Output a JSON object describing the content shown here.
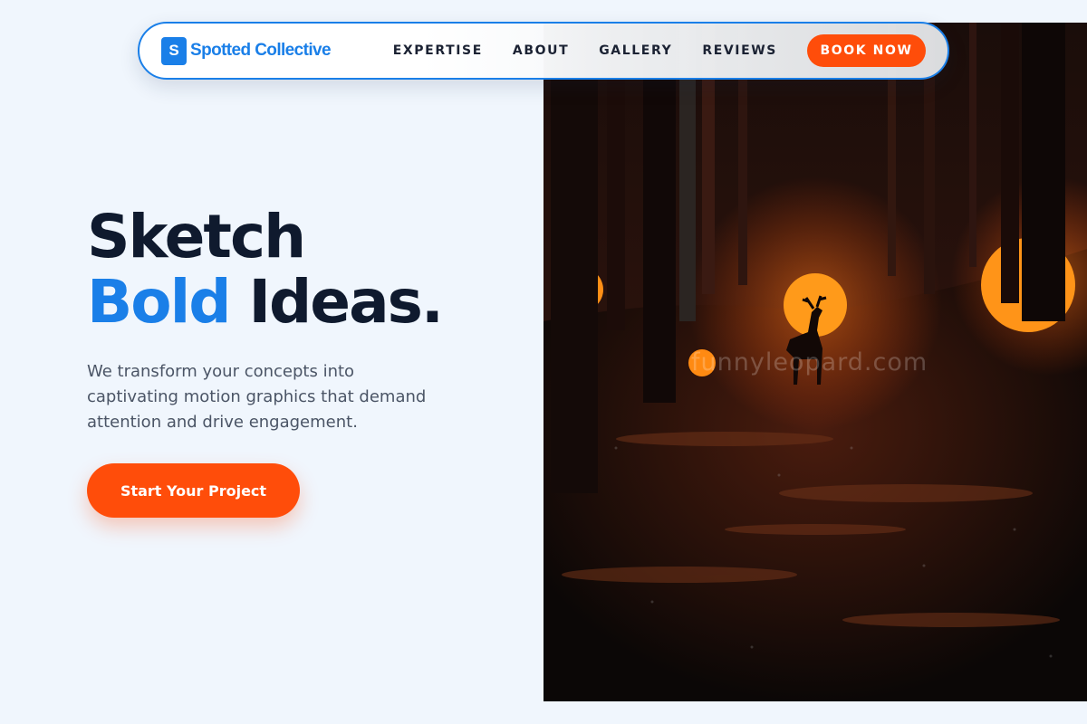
{
  "brand": {
    "logo_letter": "S",
    "name": "Spotted Collective",
    "color": "#1a7fe8"
  },
  "nav": {
    "links": [
      "EXPERTISE",
      "ABOUT",
      "GALLERY",
      "REVIEWS"
    ],
    "cta_label": "BOOK NOW",
    "cta_color": "#ff4d0a"
  },
  "hero": {
    "title_line1": "Sketch",
    "title_accent": "Bold",
    "title_rest": "Ideas.",
    "description": "We transform your concepts into captivating motion graphics that demand attention and drive engagement.",
    "cta_label": "Start Your Project",
    "accent_color": "#1a7fe8",
    "heading_color": "#0f1a2e"
  },
  "hero_image": {
    "subject": "dark forest with glowing orange orbs and a deer silhouette",
    "watermark": "funnyleopard.com"
  }
}
